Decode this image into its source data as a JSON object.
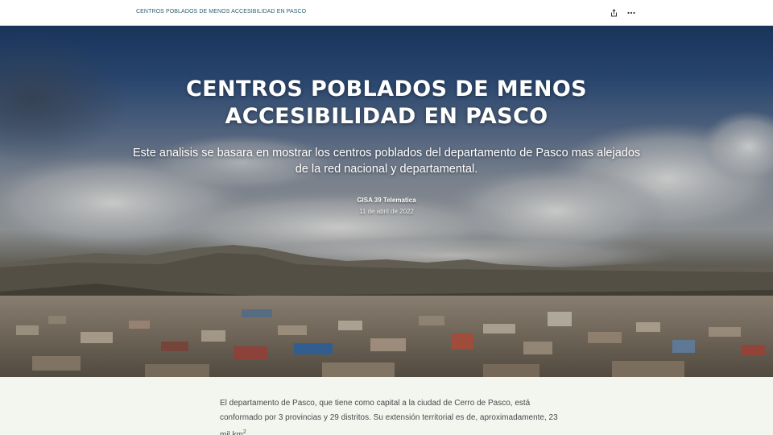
{
  "topbar": {
    "title": "CENTROS POBLADOS DE MENOS ACCESIBILIDAD EN PASCO",
    "icons": [
      "share-icon",
      "more-icon"
    ]
  },
  "hero": {
    "title": "CENTROS POBLADOS DE MENOS ACCESIBILIDAD EN PASCO",
    "subtitle": "Este analisis se basara en mostrar los centros poblados del departamento de Pasco mas alejados de la red nacional y departamental.",
    "author": "GISA 39 Telematica",
    "date": "11 de abril de 2022"
  },
  "content": {
    "paragraph_main": "El departamento de Pasco, que tiene como capital a la ciudad de Cerro de Pasco, está conformado por 3 provincias y 29 distritos. Su extensión territorial es de, aproximadamente, 23 mil km",
    "paragraph_sup": "2"
  },
  "colors": {
    "topbar_title": "#2d6070",
    "page_background": "#f3f5ef",
    "body_text": "#4a4a4a"
  }
}
